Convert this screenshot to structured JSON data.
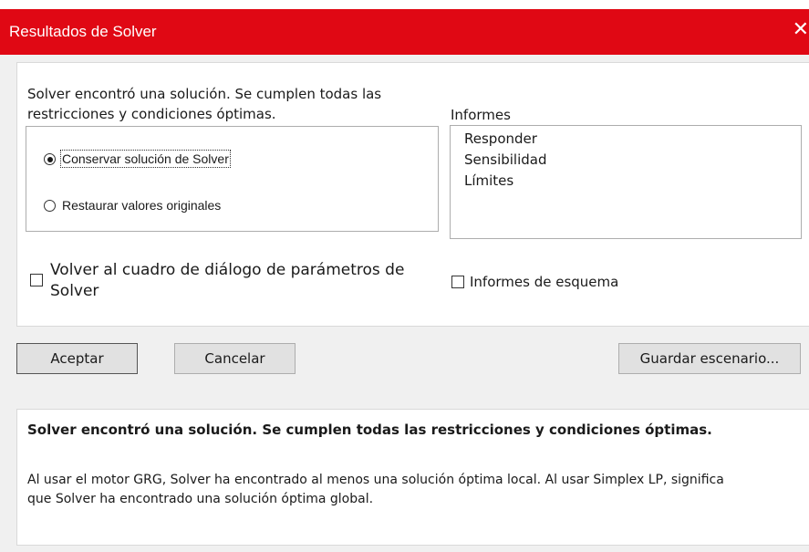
{
  "window": {
    "title": "Resultados de Solver",
    "close_glyph": "✕"
  },
  "result": {
    "message_line1": "Solver encontró una solución. Se cumplen todas las",
    "message_line2": "restricciones y condiciones óptimas."
  },
  "options": {
    "keep_solution": {
      "label": "Conservar solución de Solver",
      "selected": true
    },
    "restore_original": {
      "label": "Restaurar valores originales",
      "selected": false
    }
  },
  "reports": {
    "label": "Informes",
    "items": [
      "Responder",
      "Sensibilidad",
      "Límites"
    ]
  },
  "checkboxes": {
    "return_dialog": {
      "label": "Volver al cuadro de diálogo de parámetros de Solver",
      "checked": false
    },
    "outline_reports": {
      "label": "Informes de esquema",
      "checked": false
    }
  },
  "buttons": {
    "accept": "Aceptar",
    "cancel": "Cancelar",
    "save_scenario": "Guardar escenario..."
  },
  "footer": {
    "title": "Solver encontró una solución. Se cumplen todas las restricciones y condiciones óptimas.",
    "desc_line1": "Al usar el motor GRG, Solver ha encontrado al menos una solución óptima local. Al usar Simplex LP, significa",
    "desc_line2": "que Solver ha encontrado una solución óptima global."
  },
  "colors": {
    "titlebar": "#e00814",
    "dialog_bg": "#f0f0f0",
    "button_bg": "#e1e1e1"
  },
  "icons": [
    "close-icon",
    "radio-selected-icon",
    "radio-empty-icon",
    "checkbox-icon"
  ]
}
